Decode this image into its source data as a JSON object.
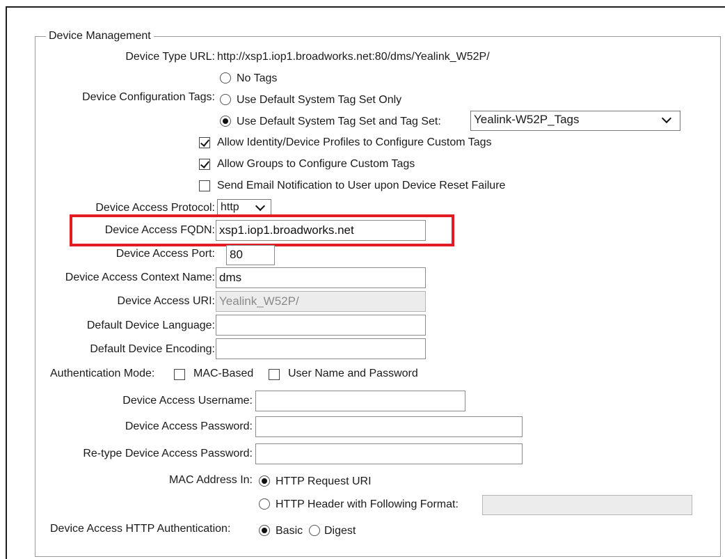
{
  "section": {
    "legend": "Device Management"
  },
  "device_type_url": {
    "label": "Device Type URL:",
    "value": "http://xsp1.iop1.broadworks.net:80/dms/Yealink_W52P/"
  },
  "config_tags": {
    "label": "Device Configuration Tags:",
    "options": [
      "No Tags",
      "Use Default System Tag Set Only",
      "Use Default System Tag Set and Tag Set:"
    ],
    "selected_index": 2,
    "tag_set_value": "Yealink-W52P_Tags"
  },
  "checkboxes": [
    {
      "label": "Allow Identity/Device Profiles to Configure Custom Tags",
      "checked": true
    },
    {
      "label": "Allow Groups to Configure Custom Tags",
      "checked": true
    },
    {
      "label": "Send Email Notification to User upon Device Reset Failure",
      "checked": false
    }
  ],
  "protocol": {
    "label": "Device Access Protocol:",
    "value": "http"
  },
  "fqdn": {
    "label": "Device Access FQDN:",
    "value": "xsp1.iop1.broadworks.net"
  },
  "port": {
    "label": "Device Access Port:",
    "value": "80"
  },
  "context": {
    "label": "Device Access Context Name:",
    "value": "dms"
  },
  "uri": {
    "label": "Device Access URI:",
    "value": "Yealink_W52P/"
  },
  "language": {
    "label": "Default Device Language:",
    "value": ""
  },
  "encoding": {
    "label": "Default Device Encoding:",
    "value": ""
  },
  "auth_mode": {
    "label": "Authentication Mode:",
    "options": [
      {
        "label": "MAC-Based",
        "checked": false
      },
      {
        "label": "User Name and Password",
        "checked": false
      }
    ]
  },
  "username": {
    "label": "Device Access Username:",
    "value": ""
  },
  "password": {
    "label": "Device Access Password:",
    "value": ""
  },
  "retype_password": {
    "label": "Re-type Device Access Password:",
    "value": ""
  },
  "mac_address_in": {
    "label": "MAC Address In:",
    "options": [
      "HTTP Request URI",
      "HTTP Header with Following Format:"
    ],
    "selected_index": 0,
    "header_format_value": ""
  },
  "http_auth": {
    "label": "Device Access HTTP Authentication:",
    "options": [
      "Basic",
      "Digest"
    ],
    "selected_index": 0
  },
  "highlight_color": "#e31b23"
}
